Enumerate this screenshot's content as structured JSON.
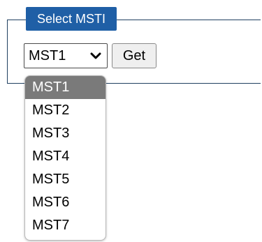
{
  "fieldset": {
    "legend": "Select MSTI"
  },
  "select": {
    "value": "MST1",
    "icon": "chevron-down-icon"
  },
  "get_button": {
    "label": "Get"
  },
  "dropdown": {
    "options": [
      "MST1",
      "MST2",
      "MST3",
      "MST4",
      "MST5",
      "MST6",
      "MST7"
    ],
    "selected_index": 0
  },
  "colors": {
    "legend_bg": "#1f5fa6",
    "selected_option_bg": "#7a7a7a"
  }
}
